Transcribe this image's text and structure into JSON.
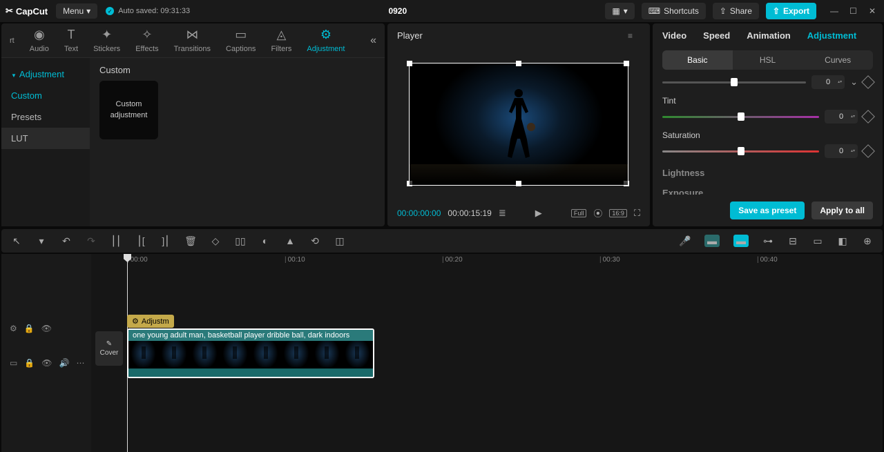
{
  "titlebar": {
    "logo": "CapCut",
    "menu": "Menu",
    "autosave": "Auto saved: 09:31:33",
    "project": "0920",
    "shortcuts": "Shortcuts",
    "share": "Share",
    "export": "Export"
  },
  "featureTabs": {
    "rt": "rt",
    "audio": "Audio",
    "text": "Text",
    "stickers": "Stickers",
    "effects": "Effects",
    "transitions": "Transitions",
    "captions": "Captions",
    "filters": "Filters",
    "adjustment": "Adjustment"
  },
  "sidebar": {
    "header": "Adjustment",
    "custom": "Custom",
    "presets": "Presets",
    "lut": "LUT"
  },
  "content": {
    "heading": "Custom",
    "thumb": "Custom adjustment"
  },
  "player": {
    "title": "Player",
    "timecode": "00:00:00:00",
    "duration": "00:00:15:19",
    "ratio": "16:9",
    "full": "Full"
  },
  "rightTabs": {
    "video": "Video",
    "speed": "Speed",
    "animation": "Animation",
    "adjustment": "Adjustment"
  },
  "subTabs": {
    "basic": "Basic",
    "hsl": "HSL",
    "curves": "Curves"
  },
  "params": {
    "topVal": "0",
    "tint": "Tint",
    "tintVal": "0",
    "saturation": "Saturation",
    "satVal": "0",
    "lightness": "Lightness",
    "exposure": "Exposure"
  },
  "footer": {
    "save": "Save as preset",
    "apply": "Apply to all"
  },
  "timeline": {
    "marks": [
      "00:00",
      "00:10",
      "00:20",
      "00:30",
      "00:40"
    ],
    "adjustPill": "Adjustm",
    "clipLabel": "one young adult man, basketball player dribble ball, dark indoors",
    "cover": "Cover"
  }
}
